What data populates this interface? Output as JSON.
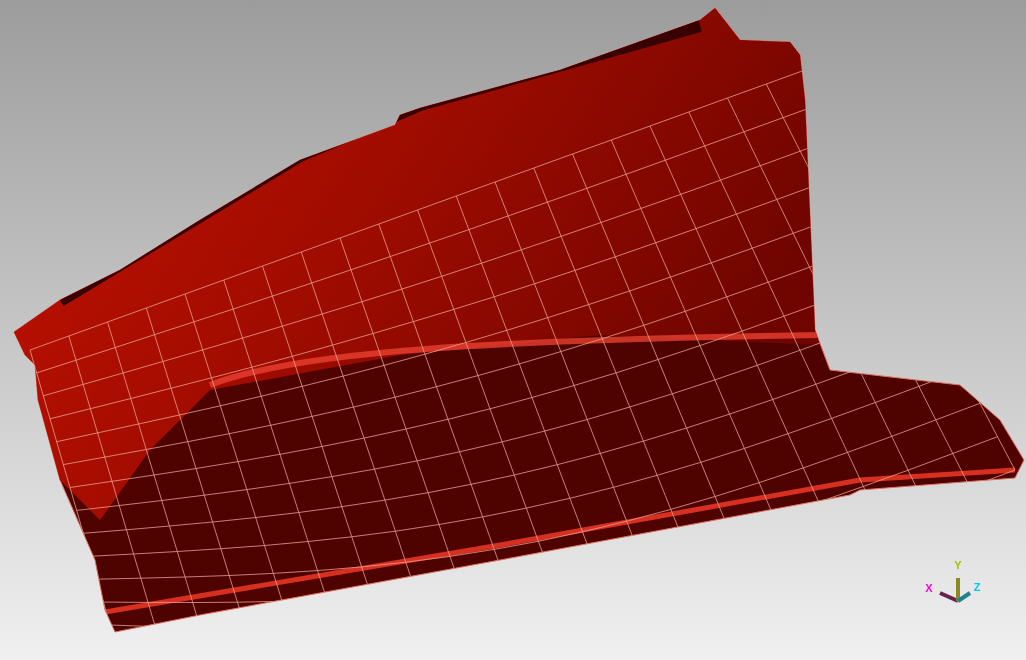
{
  "axis_triad": {
    "axes": [
      {
        "kind": "x",
        "label": "X",
        "color": "#ff00cc"
      },
      {
        "kind": "y",
        "label": "Y",
        "color": "#a8c000"
      },
      {
        "kind": "z",
        "label": "Z",
        "color": "#00c8f0"
      }
    ]
  }
}
